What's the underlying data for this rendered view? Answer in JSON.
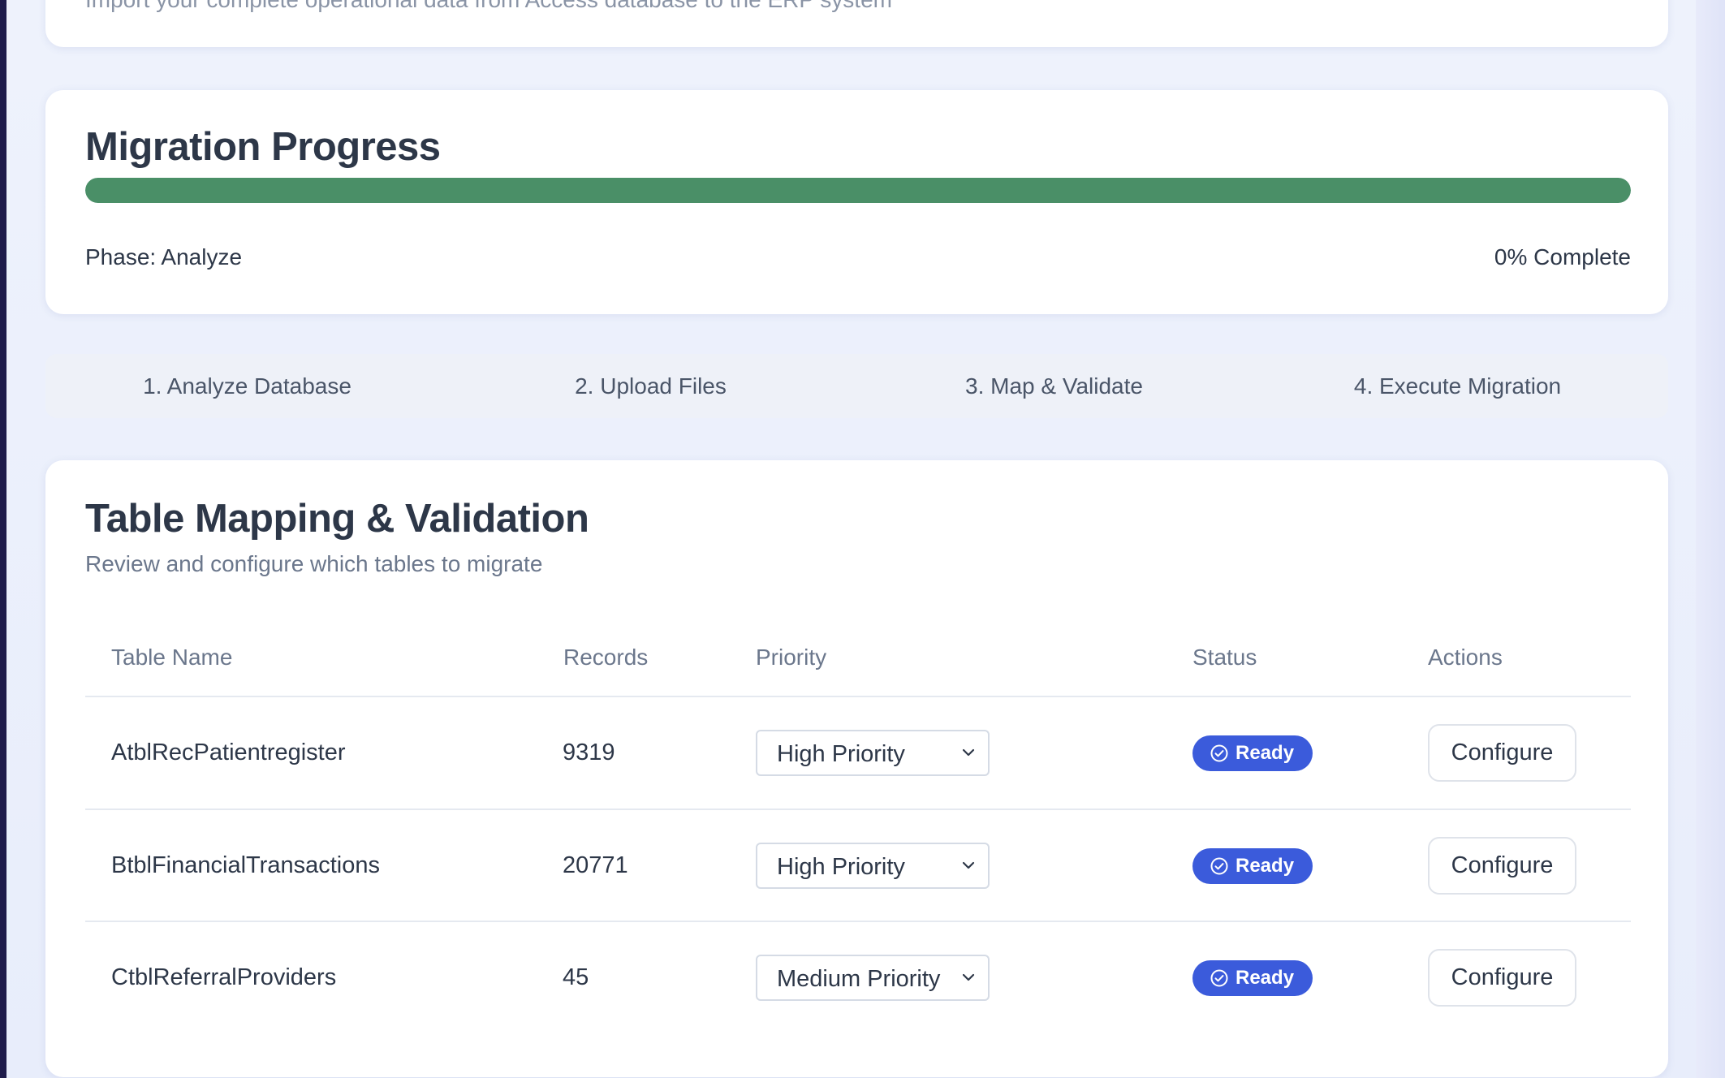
{
  "header_card": {
    "subtitle": "Import your complete operational data from Access database to the ERP system"
  },
  "progress": {
    "title": "Migration Progress",
    "fill_fraction": 1.0,
    "fill_color": "#4a8f67",
    "phase": "Phase: Analyze",
    "percent_label": "0% Complete"
  },
  "steps": [
    {
      "label": "1. Analyze Database"
    },
    {
      "label": "2. Upload Files"
    },
    {
      "label": "3. Map & Validate"
    },
    {
      "label": "4. Execute Migration"
    }
  ],
  "mapping": {
    "title": "Table Mapping & Validation",
    "description": "Review and configure which tables to migrate",
    "columns": [
      "Table Name",
      "Records",
      "Priority",
      "Status",
      "Actions"
    ],
    "rows": [
      {
        "name": "AtblRecPatientregister",
        "records": "9319",
        "priority": "High Priority",
        "status": "Ready",
        "action": "Configure"
      },
      {
        "name": "BtblFinancialTransactions",
        "records": "20771",
        "priority": "High Priority",
        "status": "Ready",
        "action": "Configure"
      },
      {
        "name": "CtblReferralProviders",
        "records": "45",
        "priority": "Medium Priority",
        "status": "Ready",
        "action": "Configure"
      }
    ]
  },
  "colors": {
    "accent": "#3b5bdb",
    "progress": "#4a8f67"
  },
  "icons": {
    "status": "check-circle-icon",
    "select": "chevron-down-icon"
  }
}
